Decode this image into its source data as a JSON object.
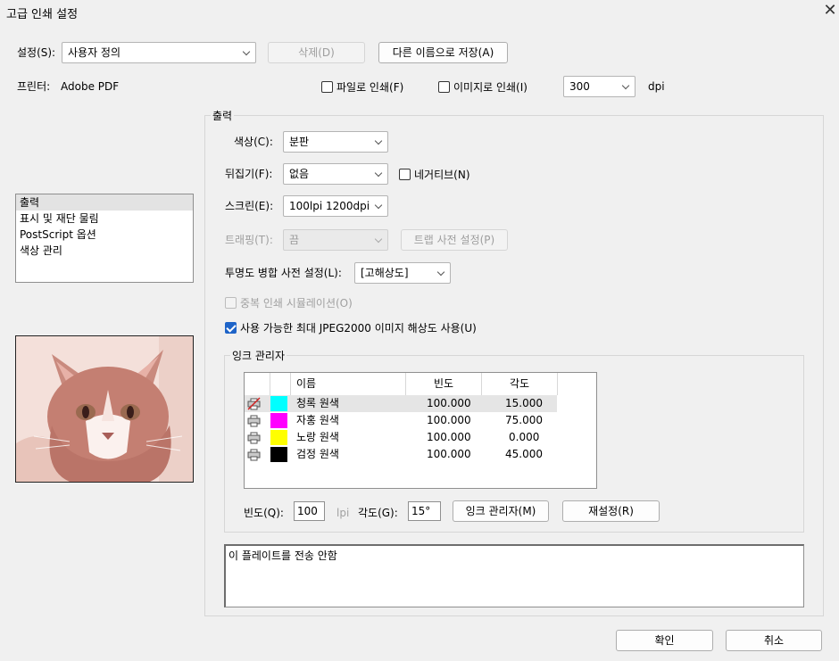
{
  "window": {
    "title": "고급 인쇄 설정",
    "close_glyph": "✕"
  },
  "settings": {
    "label": "설정(S):",
    "value": "사용자 정의",
    "delete_label": "삭제(D)",
    "save_as_label": "다른 이름으로 저장(A)"
  },
  "printer": {
    "label": "프린터:",
    "name": "Adobe PDF",
    "print_to_file_label": "파일로 인쇄(F)",
    "print_to_file_checked": false,
    "print_as_image_label": "이미지로 인쇄(I)",
    "print_as_image_checked": false,
    "dpi_value": "300",
    "dpi_unit": "dpi"
  },
  "sidebar": {
    "items": [
      {
        "label": "출력",
        "selected": true
      },
      {
        "label": "표시 및 재단 물림",
        "selected": false
      },
      {
        "label": "PostScript 옵션",
        "selected": false
      },
      {
        "label": "색상 관리",
        "selected": false
      }
    ]
  },
  "output": {
    "group_title": "출력",
    "color_label": "색상(C):",
    "color_value": "분판",
    "flip_label": "뒤집기(F):",
    "flip_value": "없음",
    "negative_label": "네거티브(N)",
    "negative_checked": false,
    "screen_label": "스크린(E):",
    "screen_value": "100lpi 1200dpi",
    "trapping_label": "트래핑(T):",
    "trapping_value": "끔",
    "trap_presets_label": "트랩 사전 설정(P)",
    "transparency_label": "투명도 병합 사전 설정(L):",
    "transparency_value": "[고해상도]",
    "simulate_overprint_label": "중복 인쇄 시뮬레이션(O)",
    "simulate_overprint_checked": false,
    "jpeg2000_label": "사용 가능한 최대 JPEG2000 이미지 해상도 사용(U)",
    "jpeg2000_checked": true
  },
  "ink_manager": {
    "group_title": "잉크 관리자",
    "columns": [
      "이름",
      "빈도",
      "각도"
    ],
    "rows": [
      {
        "name": "청록 원색",
        "frequency": "100.000",
        "angle": "15.000",
        "color": "#00ffff",
        "icon": "printer-disabled-icon",
        "selected": true
      },
      {
        "name": "자홍 원색",
        "frequency": "100.000",
        "angle": "75.000",
        "color": "#ff00ff",
        "icon": "printer-icon",
        "selected": false
      },
      {
        "name": "노랑 원색",
        "frequency": "100.000",
        "angle": "0.000",
        "color": "#ffff00",
        "icon": "printer-icon",
        "selected": false
      },
      {
        "name": "검정 원색",
        "frequency": "100.000",
        "angle": "45.000",
        "color": "#000000",
        "icon": "printer-icon",
        "selected": false
      }
    ],
    "frequency_label": "빈도(Q):",
    "frequency_value": "100",
    "frequency_unit": "lpi",
    "angle_label": "각도(G):",
    "angle_value": "15°",
    "ink_manager_button": "잉크 관리자(M)",
    "reset_button": "재설정(R)"
  },
  "description": "이 플레이트를 전송 안함",
  "footer": {
    "ok_label": "확인",
    "cancel_label": "취소"
  }
}
